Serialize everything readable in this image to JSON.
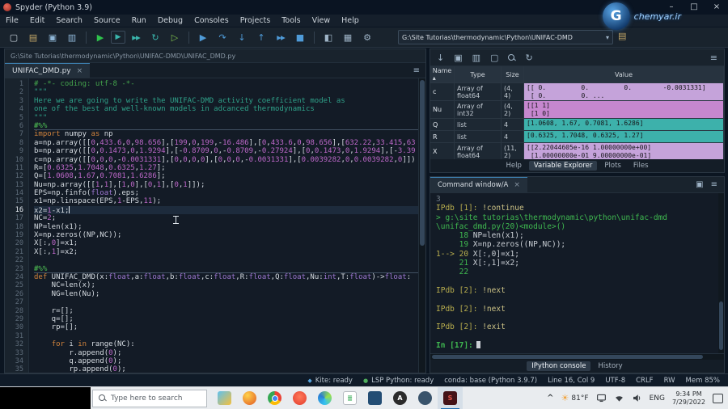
{
  "window": {
    "title": "Spyder (Python 3.9)",
    "minimize": "–",
    "maximize": "□",
    "close": "×"
  },
  "watermark": {
    "text": "chemyar.ir",
    "letter": "G"
  },
  "menubar": {
    "items": [
      "File",
      "Edit",
      "Search",
      "Source",
      "Run",
      "Debug",
      "Consoles",
      "Projects",
      "Tools",
      "View",
      "Help"
    ]
  },
  "toolbar": {
    "buttons": [
      {
        "name": "new-file-button",
        "glyph": "▢",
        "color": "#c8d2da"
      },
      {
        "name": "open-file-button",
        "glyph": "▤",
        "color": "#c2a768"
      },
      {
        "name": "save-button",
        "glyph": "▣",
        "color": "#8fb7d8"
      },
      {
        "name": "save-all-button",
        "glyph": "▥",
        "color": "#8fb7d8"
      },
      {
        "sep": true
      },
      {
        "name": "run-file-button",
        "glyph": "▶",
        "color": "#2fc24c"
      },
      {
        "name": "run-cell-button",
        "glyph": "▶",
        "color": "#3ab5ac",
        "boxed": true
      },
      {
        "name": "run-cell-advance-button",
        "glyph": "▶▶",
        "color": "#3ab5ac",
        "small": true
      },
      {
        "name": "rerun-cell-button",
        "glyph": "↻",
        "color": "#3ab5ac"
      },
      {
        "name": "run-selection-button",
        "glyph": "▷",
        "color": "#7fc24c"
      },
      {
        "sep": true
      },
      {
        "name": "debug-file-button",
        "glyph": "▶",
        "color": "#4f9bd8"
      },
      {
        "name": "step-button",
        "glyph": "↷",
        "color": "#4f9bd8"
      },
      {
        "name": "step-into-button",
        "glyph": "↓",
        "color": "#4f9bd8"
      },
      {
        "name": "step-out-button",
        "glyph": "↑",
        "color": "#4f9bd8"
      },
      {
        "name": "continue-button",
        "glyph": "▶▶",
        "color": "#4f9bd8",
        "small": true
      },
      {
        "name": "stop-debug-button",
        "glyph": "■",
        "color": "#4f9bd8"
      },
      {
        "sep": true
      },
      {
        "name": "maximize-pane-button",
        "glyph": "◧",
        "color": "#9fb4c7"
      },
      {
        "name": "layout-button",
        "glyph": "▦",
        "color": "#9fb4c7"
      },
      {
        "name": "preferences-button",
        "glyph": "⚙",
        "color": "#9fb4c7"
      }
    ],
    "path_value": "G:\\Site Tutorias\\thermodynamic\\Python\\UNIFAC-DMD",
    "dropdown_caret": "▾",
    "browse_glyph": "▤"
  },
  "editor": {
    "breadcrumb": "G:\\Site Tutorias\\thermodynamic\\Python\\UNIFAC-DMD\\UNIFAC_DMD.py",
    "tab_label": "UNIFAC_DMD.py",
    "tab_close": "×",
    "options_glyph": "≡",
    "current_line": 16,
    "lines": [
      [
        1,
        "c",
        "# -*- coding: utf-8 -*-"
      ],
      [
        2,
        "s",
        "\"\"\""
      ],
      [
        3,
        "s",
        "Here we are going to write the UNIFAC-DMD activity coefficient model as"
      ],
      [
        4,
        "s",
        "one of the best and well-known models in adcanced thermodynamics"
      ],
      [
        5,
        "s",
        "\"\"\""
      ],
      [
        6,
        "x",
        "#%%"
      ],
      [
        7,
        "",
        "import numpy as np"
      ],
      [
        8,
        "",
        "a=np.array([[0,433.6,0,98.656],[199,0,199,-16.486],[0,433.6,0,98.656],[632.22,33.415,63"
      ],
      [
        9,
        "",
        "b=np.array([[0,0.1473,0,1.9294],[-0.8709,0,-0.8709,-0.27924],[0,0.1473,0,1.9294],[-3.39"
      ],
      [
        10,
        "",
        "c=np.array([[0,0,0,-0.0031331],[0,0,0,0],[0,0,0,-0.0031331],[0.0039282,0,0.0039282,0]])"
      ],
      [
        11,
        "",
        "R=[0.6325,1.7048,0.6325,1.27];"
      ],
      [
        12,
        "",
        "Q=[1.0608,1.67,0.7081,1.6286];"
      ],
      [
        13,
        "",
        "Nu=np.array([[1,1],[1,0],[0,1],[0,1]]);"
      ],
      [
        14,
        "",
        "EPS=np.finfo(float).eps;"
      ],
      [
        15,
        "",
        "x1=np.linspace(EPS,1-EPS,11);"
      ],
      [
        16,
        "",
        "x2=1-x1;"
      ],
      [
        17,
        "",
        "NC=2;"
      ],
      [
        18,
        "",
        "NP=len(x1);"
      ],
      [
        19,
        "",
        "X=np.zeros((NP,NC));"
      ],
      [
        20,
        "",
        "X[:,0]=x1;"
      ],
      [
        21,
        "",
        "X[:,1]=x2;"
      ],
      [
        22,
        "",
        ""
      ],
      [
        23,
        "x",
        "#%%"
      ],
      [
        24,
        "",
        "def UNIFAC_DMD(x:float,a:float,b:float,c:float,R:float,Q:float,Nu:int,T:float)->float:"
      ],
      [
        25,
        "",
        "    NC=len(x);"
      ],
      [
        26,
        "",
        "    NG=len(Nu);"
      ],
      [
        27,
        "",
        ""
      ],
      [
        28,
        "",
        "    r=[];"
      ],
      [
        29,
        "",
        "    q=[];"
      ],
      [
        30,
        "",
        "    rp=[];"
      ],
      [
        31,
        "",
        ""
      ],
      [
        32,
        "",
        "    for i in range(NC):"
      ],
      [
        33,
        "",
        "        r.append(0);"
      ],
      [
        34,
        "",
        "        q.append(0);"
      ],
      [
        35,
        "",
        "        rp.append(0);"
      ]
    ]
  },
  "variable_explorer": {
    "toolbar": [
      {
        "name": "import-data-icon",
        "glyph": "↓"
      },
      {
        "name": "save-data-icon",
        "glyph": "▣"
      },
      {
        "name": "save-data-as-icon",
        "glyph": "▥"
      },
      {
        "name": "remove-variable-icon",
        "glyph": "▢"
      },
      {
        "name": "search-icon",
        "glyph": "mag"
      },
      {
        "name": "refresh-icon",
        "glyph": "↻"
      }
    ],
    "options_glyph": "≡",
    "columns": [
      "Name",
      "Type",
      "Size",
      "Value"
    ],
    "sort_indicator": "▴",
    "rows": [
      {
        "name": "c",
        "type": "Array of float64",
        "size": "(4, 4)",
        "value": "[[ 0.         0.         0.        -0.0031331]\n [ 0.         0. ...",
        "color": "purple",
        "tall": true
      },
      {
        "name": "Nu",
        "type": "Array of int32",
        "size": "(4, 2)",
        "value": "[[1 1]\n [1 0]",
        "color": "magenta",
        "tall": true
      },
      {
        "name": "Q",
        "type": "list",
        "size": "4",
        "value": "[1.0608, 1.67, 0.7081, 1.6286]",
        "color": "teal"
      },
      {
        "name": "R",
        "type": "list",
        "size": "4",
        "value": "[0.6325, 1.7048, 0.6325, 1.27]",
        "color": "teal"
      },
      {
        "name": "X",
        "type": "Array of float64",
        "size": "(11, 2)",
        "value": "[[2.22044605e-16 1.00000000e+00]\n [1.00000000e-01 9.00000000e-01]",
        "color": "purple",
        "tall": true
      }
    ],
    "tabs": [
      "Help",
      "Variable Explorer",
      "Plots",
      "Files"
    ],
    "active_tab": "Variable Explorer"
  },
  "console": {
    "tab_label": "Command window/A",
    "tab_close": "×",
    "toolbar_glyphs": {
      "inspect": "▣",
      "options": "≡"
    },
    "lines": [
      [
        [
          "ctx",
          "3"
        ]
      ],
      [
        [
          "ip",
          "IPdb [1]: "
        ],
        [
          "cmd",
          "!continue"
        ]
      ],
      [
        [
          "path",
          "> g:\\site tutorias\\thermodynamic\\python\\unifac-dmd"
        ]
      ],
      [
        [
          "path",
          "\\unifac_dmd.py(20)<module>()"
        ]
      ],
      [
        [
          "ln",
          "     18 "
        ],
        [
          "code-t",
          "NP=len(x1);"
        ]
      ],
      [
        [
          "ln",
          "     19 "
        ],
        [
          "code-t",
          "X=np.zeros((NP,NC));"
        ]
      ],
      [
        [
          "arr",
          "1--> 20 "
        ],
        [
          "code-t",
          "X[:,0]=x1;"
        ]
      ],
      [
        [
          "ln",
          "     21 "
        ],
        [
          "code-t",
          "X[:,1]=x2;"
        ]
      ],
      [
        [
          "ln",
          "     22"
        ]
      ],
      [],
      [
        [
          "ip",
          "IPdb [2]: "
        ],
        [
          "cmd",
          "!next"
        ]
      ],
      [],
      [
        [
          "ip",
          "IPdb [2]: "
        ],
        [
          "cmd",
          "!next"
        ]
      ],
      [],
      [
        [
          "ip",
          "IPdb [2]: "
        ],
        [
          "cmd",
          "!exit"
        ]
      ],
      [],
      [
        [
          "inp",
          "In [17]:"
        ]
      ]
    ],
    "tabs": [
      "IPython console",
      "History"
    ],
    "active_tab": "IPython console"
  },
  "statusbar": {
    "items": [
      {
        "name": "kite-status",
        "text": "Kite: ready",
        "icon": "◆",
        "icon_color": "#58a6e0"
      },
      {
        "name": "lsp-status",
        "text": "LSP Python: ready",
        "icon": "●",
        "icon_color": "#4fae5c"
      },
      {
        "name": "conda-status",
        "text": "conda: base (Python 3.9.7)"
      },
      {
        "name": "cursor-position",
        "text": "Line 16, Col 9"
      },
      {
        "name": "encoding-status",
        "text": "UTF-8"
      },
      {
        "name": "eol-status",
        "text": "CRLF"
      },
      {
        "name": "readwrite-status",
        "text": "RW"
      },
      {
        "name": "memory-status",
        "text": "Mem 85%"
      }
    ]
  },
  "taskbar": {
    "search_placeholder": "Type here to search",
    "apps": [
      {
        "name": "taskbar-weather-app",
        "bg": "linear-gradient(135deg,#5ec1f0,#f6c03b)",
        "shape": "square"
      },
      {
        "name": "taskbar-firefox",
        "bg": "radial-gradient(circle at 35% 30%,#ffd24a,#e8762d 75%)",
        "shape": "circle"
      },
      {
        "name": "taskbar-chrome",
        "bg": "conic-gradient(#ea4335 0 33%,#fbbc05 33% 62%,#34a853 62% 100%)",
        "shape": "circle",
        "dot": "#4285f4"
      },
      {
        "name": "taskbar-opera",
        "bg": "radial-gradient(circle at 50% 40%,#ff7a59,#e23b2e)",
        "shape": "circle"
      },
      {
        "name": "taskbar-edge",
        "bg": "conic-gradient(from 180deg,#35c1f1,#2b7cd3,#98e04b,#35c1f1)",
        "shape": "circle"
      },
      {
        "name": "taskbar-pdf-tool",
        "bg": "#ffffff",
        "shape": "square",
        "text": "≣",
        "color": "#2da84f",
        "border": true
      },
      {
        "name": "taskbar-blue-app",
        "bg": "#234d74",
        "shape": "square"
      },
      {
        "name": "taskbar-anydesk",
        "bg": "#2b2b2b",
        "shape": "circle",
        "text": "A",
        "color": "#ffffff"
      },
      {
        "name": "taskbar-dark-app",
        "bg": "#39536b",
        "shape": "circle"
      },
      {
        "name": "taskbar-spyder",
        "bg": "#441318",
        "shape": "square",
        "text": "S",
        "color": "#e2574c",
        "active": true
      }
    ],
    "tray": {
      "chevron": "^",
      "weather_glyph": "☀",
      "temperature": "81°F",
      "language": "ENG",
      "time": "9:34 PM",
      "date": "7/29/2022"
    }
  }
}
